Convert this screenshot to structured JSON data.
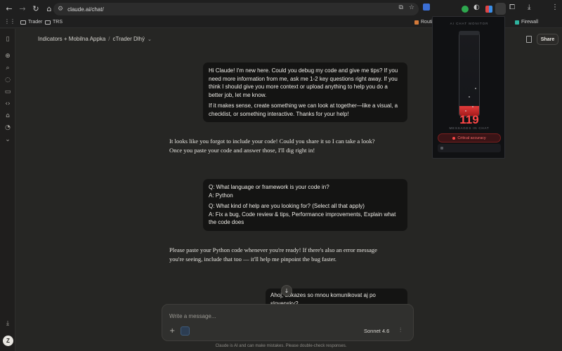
{
  "browser": {
    "url": "claude.ai/chat/",
    "bookmarks": [
      "Trader",
      "TRS"
    ],
    "bookmark_right": [
      "Routi",
      "Firewall"
    ]
  },
  "header": {
    "breadcrumb_project": "Indicators + Mobilna Appka",
    "breadcrumb_chat": "cTrader Dlhý",
    "share_label": "Share"
  },
  "messages": {
    "user1_p1": "Hi Claude! I'm new here. Could you debug my code and give me tips? If you need more information from me, ask me 1-2 key questions right away. If you think I should give you more context or upload anything to help you do a better job, let me know.",
    "user1_p2": "If it makes sense, create something we can look at together—like a visual, a checklist, or something interactive. Thanks for your help!",
    "ai1": "It looks like you forgot to include your code! Could you share it so I can take a look? Once you paste your code and answer those, I'll dig right in!",
    "user2_q1": "Q: What language or framework is your code in?",
    "user2_a1": "A: Python",
    "user2_q2": "Q: What kind of help are you looking for? (Select all that apply)",
    "user2_a2": "A: Fix a bug, Code review & tips, Performance improvements, Explain what the code does",
    "ai2": "Please paste your Python code whenever you're ready! If there's also an error message you're seeing, include that too — it'll help me pinpoint the bug faster.",
    "user3": "Ahoj, dokazes so mnou komunikovat aj po slovensky?"
  },
  "composer": {
    "placeholder": "Write a message...",
    "model": "Sonnet 4.6"
  },
  "disclaimer": "Claude is AI and can make mistakes. Please double-check responses.",
  "avatar_initial": "Z",
  "monitor": {
    "title": "AI CHAT MONITOR",
    "count": "119",
    "count_label": "MESSAGES IN CHAT",
    "status": "Critical accuracy",
    "fill_level": 0.12,
    "progress": 0.12,
    "accent": "#e23b3b"
  },
  "icons": {
    "sidebar": [
      "sidebar-toggle-icon",
      "new-chat-icon",
      "search-icon",
      "chats-icon",
      "projects-icon",
      "code-icon",
      "artifacts-icon",
      "customize-icon",
      "expand-icon",
      "download-icon"
    ]
  }
}
